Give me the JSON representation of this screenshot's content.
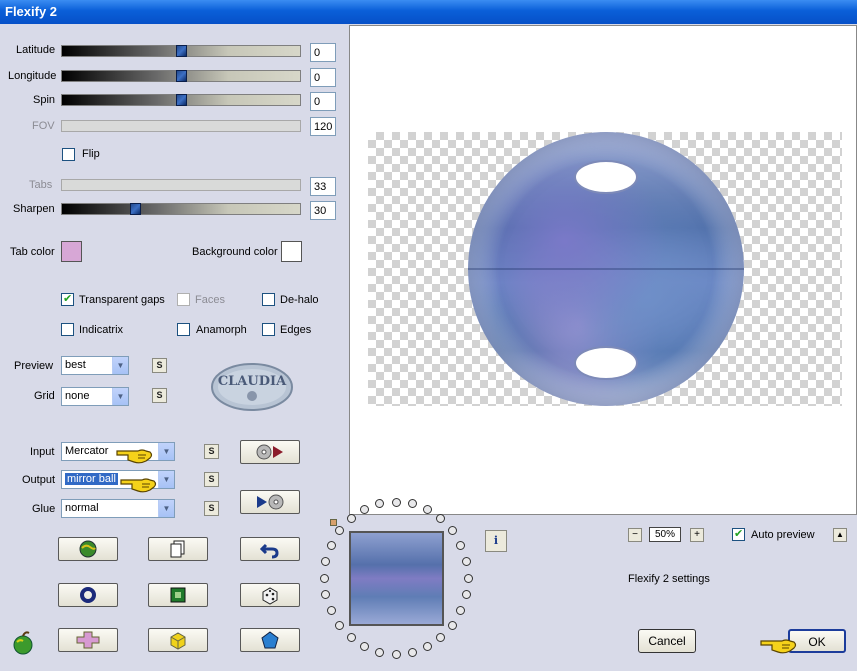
{
  "window": {
    "title": "Flexify 2"
  },
  "params": [
    {
      "label": "Latitude",
      "value": "0",
      "level": 0.5,
      "enabled": true
    },
    {
      "label": "Longitude",
      "value": "0",
      "level": 0.5,
      "enabled": true
    },
    {
      "label": "Spin",
      "value": "0",
      "level": 0.5,
      "enabled": true
    },
    {
      "label": "FOV",
      "value": "120",
      "level": 0,
      "enabled": false
    },
    {
      "label": "Tabs",
      "value": "33",
      "level": 0,
      "enabled": false
    },
    {
      "label": "Sharpen",
      "value": "30",
      "level": 0.3,
      "enabled": true
    }
  ],
  "flip": {
    "label": "Flip",
    "checked": false
  },
  "colors": {
    "tab_label": "Tab color",
    "tab_color": "#d7a7d6",
    "bg_label": "Background color",
    "bg_color": "#ffffff"
  },
  "options": [
    {
      "label": "Transparent gaps",
      "checked": true,
      "enabled": true
    },
    {
      "label": "Faces",
      "checked": false,
      "enabled": false
    },
    {
      "label": "De-halo",
      "checked": false,
      "enabled": true
    },
    {
      "label": "Indicatrix",
      "checked": false,
      "enabled": true
    },
    {
      "label": "Anamorph",
      "checked": false,
      "enabled": true
    },
    {
      "label": "Edges",
      "checked": false,
      "enabled": true
    }
  ],
  "preview_select": {
    "label": "Preview",
    "value": "best"
  },
  "grid_select": {
    "label": "Grid",
    "value": "none"
  },
  "input_select": {
    "label": "Input",
    "value": "Mercator"
  },
  "output_select": {
    "label": "Output",
    "value": "mirror ball"
  },
  "glue_select": {
    "label": "Glue",
    "value": "normal"
  },
  "s_button": "S",
  "watermark": "CLAUDIA",
  "zoom": {
    "value": "50%",
    "minus": "−",
    "plus": "+"
  },
  "auto_preview": {
    "label": "Auto preview",
    "checked": true
  },
  "collapse_glyph": "▲",
  "settings_label": "Flexify 2 settings",
  "info_glyph": "i",
  "footer": {
    "cancel": "Cancel",
    "ok": "OK"
  }
}
